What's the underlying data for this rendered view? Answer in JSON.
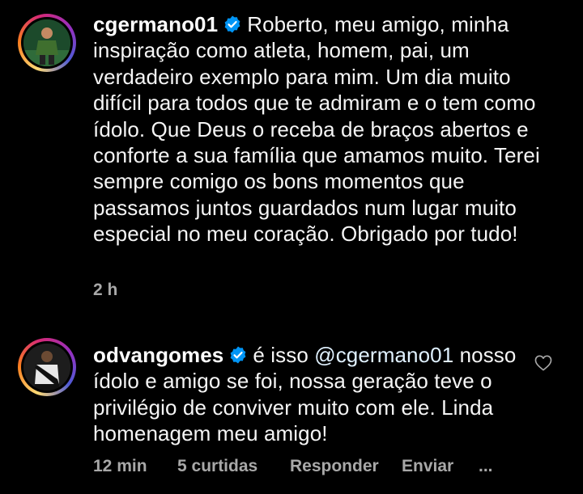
{
  "comments": [
    {
      "username": "cgermano01",
      "verified": true,
      "text": "Roberto, meu amigo, minha inspiração como atleta, homem, pai, um verdadeiro exemplo para mim. Um dia muito difícil para todos que te admiram e o tem como ídolo. Que Deus o receba de braços abertos e conforte a sua família que amamos muito. Terei sempre comigo os bons momentos que passamos juntos guardados num lugar muito especial no meu coração. Obrigado por tudo!",
      "time": "2 h"
    },
    {
      "username": "odvangomes",
      "verified": true,
      "text_prefix": "é isso ",
      "mention": "@cgermano01",
      "text_suffix": " nosso ídolo e amigo se foi, nossa geração teve o privilégio de conviver muito com ele. Linda homenagem meu amigo!",
      "time": "12 min",
      "likes": "5 curtidas",
      "reply_label": "Responder",
      "send_label": "Enviar",
      "more_label": "..."
    }
  ],
  "colors": {
    "background": "#000000",
    "text": "#f5f5f5",
    "meta": "#a8a8a8",
    "verified": "#0095f6"
  },
  "icons": {
    "verified": "verified-badge-icon",
    "like": "heart-outline-icon"
  }
}
